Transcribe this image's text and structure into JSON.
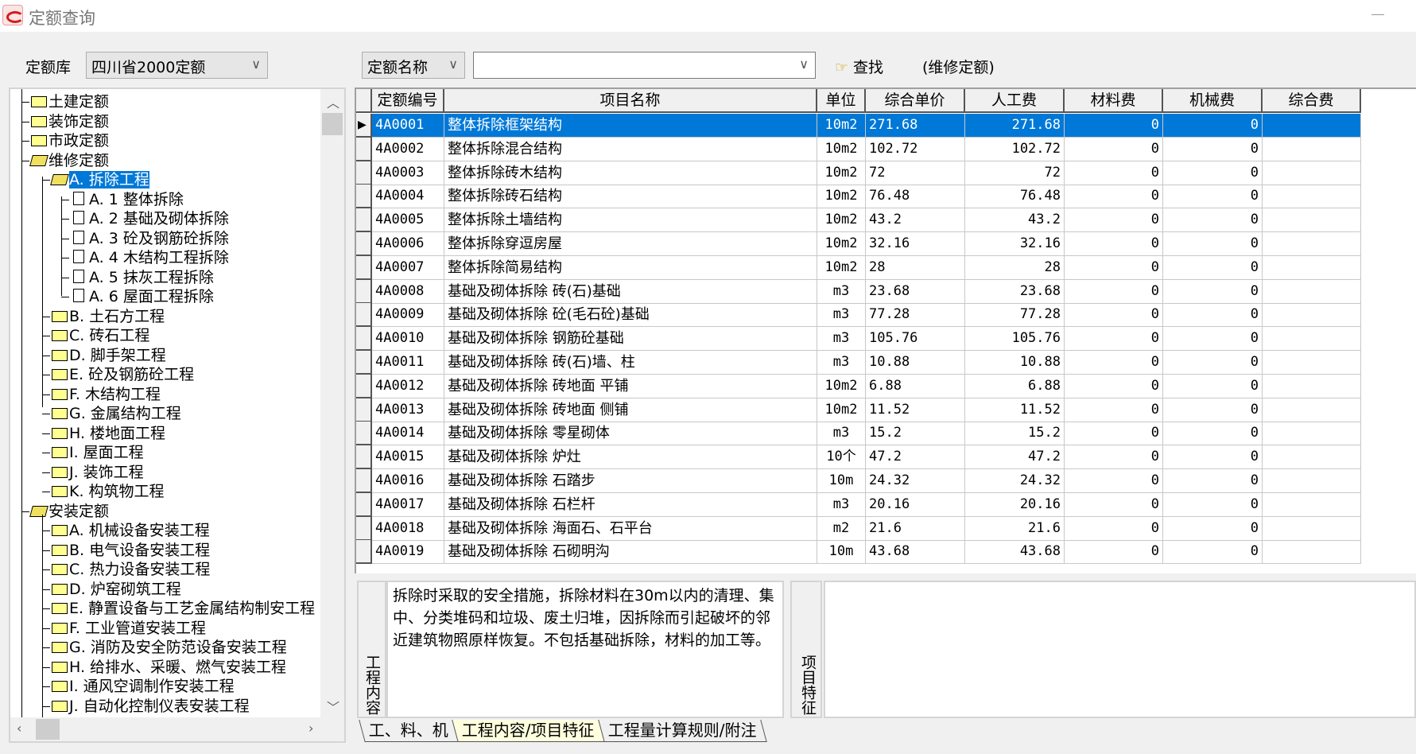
{
  "window": {
    "title": "定额查询"
  },
  "toolbar": {
    "library_label": "定额库",
    "library_value": "四川省2000定额",
    "search_field": "定额名称",
    "search_value": "",
    "find_label": "查找",
    "context": "(维修定额)"
  },
  "tree": [
    {
      "level": 0,
      "icon": "folder",
      "label": "土建定额"
    },
    {
      "level": 0,
      "icon": "folder",
      "label": "装饰定额"
    },
    {
      "level": 0,
      "icon": "folder",
      "label": "市政定额"
    },
    {
      "level": 0,
      "icon": "open",
      "label": "维修定额"
    },
    {
      "level": 1,
      "icon": "open",
      "label": "A. 拆除工程",
      "selected": true
    },
    {
      "level": 2,
      "icon": "doc",
      "label": "A. 1  整体拆除"
    },
    {
      "level": 2,
      "icon": "doc",
      "label": "A. 2  基础及砌体拆除"
    },
    {
      "level": 2,
      "icon": "doc",
      "label": "A. 3  砼及钢筋砼拆除"
    },
    {
      "level": 2,
      "icon": "doc",
      "label": "A. 4  木结构工程拆除"
    },
    {
      "level": 2,
      "icon": "doc",
      "label": "A. 5  抹灰工程拆除"
    },
    {
      "level": 2,
      "icon": "doc",
      "label": "A. 6  屋面工程拆除"
    },
    {
      "level": 1,
      "icon": "folder",
      "label": "B. 土石方工程"
    },
    {
      "level": 1,
      "icon": "folder",
      "label": "C. 砖石工程"
    },
    {
      "level": 1,
      "icon": "folder",
      "label": "D. 脚手架工程"
    },
    {
      "level": 1,
      "icon": "folder",
      "label": "E. 砼及钢筋砼工程"
    },
    {
      "level": 1,
      "icon": "folder",
      "label": "F. 木结构工程"
    },
    {
      "level": 1,
      "icon": "folder",
      "label": "G. 金属结构工程"
    },
    {
      "level": 1,
      "icon": "folder",
      "label": "H. 楼地面工程"
    },
    {
      "level": 1,
      "icon": "folder",
      "label": "I. 屋面工程"
    },
    {
      "level": 1,
      "icon": "folder",
      "label": "J. 装饰工程"
    },
    {
      "level": 1,
      "icon": "folder",
      "label": "K. 构筑物工程"
    },
    {
      "level": 0,
      "icon": "open",
      "label": "安装定额"
    },
    {
      "level": 1,
      "icon": "folder",
      "label": "A. 机械设备安装工程"
    },
    {
      "level": 1,
      "icon": "folder",
      "label": "B. 电气设备安装工程"
    },
    {
      "level": 1,
      "icon": "folder",
      "label": "C. 热力设备安装工程"
    },
    {
      "level": 1,
      "icon": "folder",
      "label": "D. 炉窑砌筑工程"
    },
    {
      "level": 1,
      "icon": "folder",
      "label": "E. 静置设备与工艺金属结构制安工程"
    },
    {
      "level": 1,
      "icon": "folder",
      "label": "F. 工业管道安装工程"
    },
    {
      "level": 1,
      "icon": "folder",
      "label": "G. 消防及安全防范设备安装工程"
    },
    {
      "level": 1,
      "icon": "folder",
      "label": "H. 给排水、采暖、燃气安装工程"
    },
    {
      "level": 1,
      "icon": "folder",
      "label": "I. 通风空调制作安装工程"
    },
    {
      "level": 1,
      "icon": "folder",
      "label": "J. 自动化控制仪表安装工程"
    }
  ],
  "grid": {
    "columns": [
      "定额编号",
      "项目名称",
      "单位",
      "综合单价",
      "人工费",
      "材料费",
      "机械费",
      "综合费"
    ],
    "rows": [
      [
        "4A0001",
        "整体拆除框架结构",
        "10m2",
        "271.68",
        "271.68",
        "0",
        "0",
        ""
      ],
      [
        "4A0002",
        "整体拆除混合结构",
        "10m2",
        "102.72",
        "102.72",
        "0",
        "0",
        ""
      ],
      [
        "4A0003",
        "整体拆除砖木结构",
        "10m2",
        "72",
        "72",
        "0",
        "0",
        ""
      ],
      [
        "4A0004",
        "整体拆除砖石结构",
        "10m2",
        "76.48",
        "76.48",
        "0",
        "0",
        ""
      ],
      [
        "4A0005",
        "整体拆除土墙结构",
        "10m2",
        "43.2",
        "43.2",
        "0",
        "0",
        ""
      ],
      [
        "4A0006",
        "整体拆除穿逗房屋",
        "10m2",
        "32.16",
        "32.16",
        "0",
        "0",
        ""
      ],
      [
        "4A0007",
        "整体拆除简易结构",
        "10m2",
        "28",
        "28",
        "0",
        "0",
        ""
      ],
      [
        "4A0008",
        "基础及砌体拆除 砖(石)基础",
        "m3",
        "23.68",
        "23.68",
        "0",
        "0",
        ""
      ],
      [
        "4A0009",
        "基础及砌体拆除 砼(毛石砼)基础",
        "m3",
        "77.28",
        "77.28",
        "0",
        "0",
        ""
      ],
      [
        "4A0010",
        "基础及砌体拆除 钢筋砼基础",
        "m3",
        "105.76",
        "105.76",
        "0",
        "0",
        ""
      ],
      [
        "4A0011",
        "基础及砌体拆除 砖(石)墙、柱",
        "m3",
        "10.88",
        "10.88",
        "0",
        "0",
        ""
      ],
      [
        "4A0012",
        "基础及砌体拆除 砖地面 平铺",
        "10m2",
        "6.88",
        "6.88",
        "0",
        "0",
        ""
      ],
      [
        "4A0013",
        "基础及砌体拆除 砖地面 侧铺",
        "10m2",
        "11.52",
        "11.52",
        "0",
        "0",
        ""
      ],
      [
        "4A0014",
        "基础及砌体拆除 零星砌体",
        "m3",
        "15.2",
        "15.2",
        "0",
        "0",
        ""
      ],
      [
        "4A0015",
        "基础及砌体拆除 炉灶",
        "10个",
        "47.2",
        "47.2",
        "0",
        "0",
        ""
      ],
      [
        "4A0016",
        "基础及砌体拆除 石踏步",
        "10m",
        "24.32",
        "24.32",
        "0",
        "0",
        ""
      ],
      [
        "4A0017",
        "基础及砌体拆除 石栏杆",
        "m3",
        "20.16",
        "20.16",
        "0",
        "0",
        ""
      ],
      [
        "4A0018",
        "基础及砌体拆除 海面石、石平台",
        "m2",
        "21.6",
        "21.6",
        "0",
        "0",
        ""
      ],
      [
        "4A0019",
        "基础及砌体拆除 石砌明沟",
        "10m",
        "43.68",
        "43.68",
        "0",
        "0",
        ""
      ]
    ]
  },
  "detail": {
    "content_tab": "工程内容",
    "feature_tab": "项目特征",
    "content_text": "拆除时采取的安全措施，拆除材料在30m以内的清理、集中、分类堆码和垃圾、废土归堆，因拆除而引起破坏的邻近建筑物照原样恢复。不包括基础拆除，材料的加工等。",
    "feature_text": ""
  },
  "tabs": [
    {
      "label": "工、料、机"
    },
    {
      "label": "工程内容/项目特征",
      "active": true
    },
    {
      "label": "工程量计算规则/附注"
    }
  ],
  "colors": {
    "selection": "#0078d7"
  }
}
